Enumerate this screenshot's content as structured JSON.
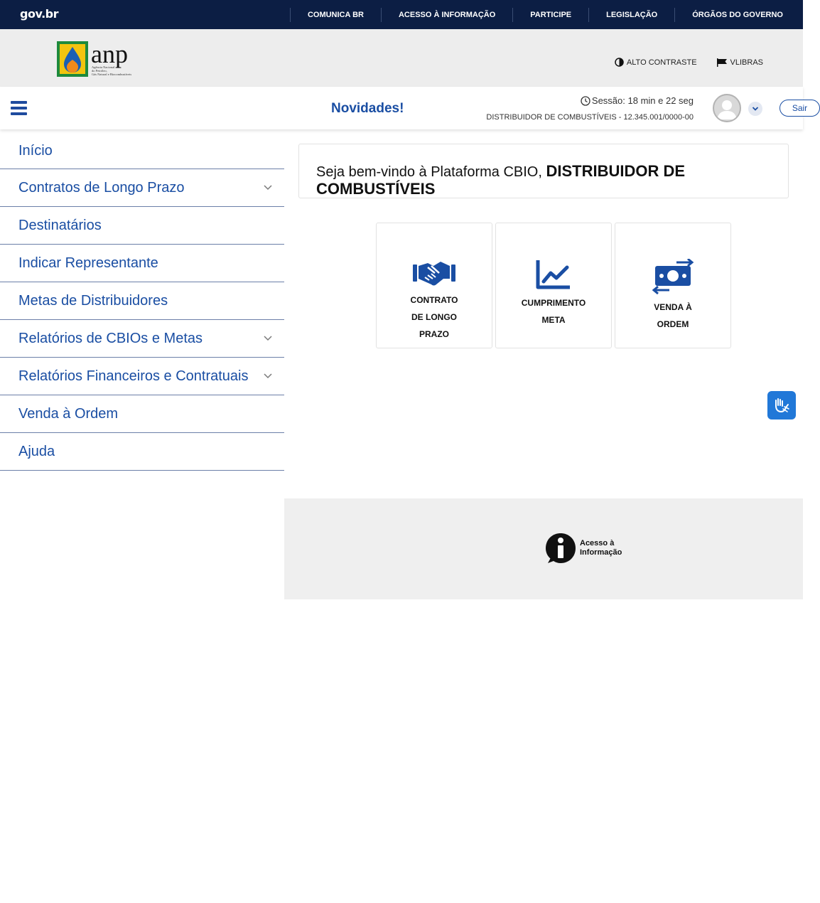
{
  "govbar": {
    "logo": "gov.br",
    "links": [
      "COMUNICA BR",
      "ACESSO À INFORMAÇÃO",
      "PARTICIPE",
      "LEGISLAÇÃO",
      "ÓRGÃOS DO GOVERNO"
    ]
  },
  "anp": {
    "logo_text": "anp",
    "logo_subtext": "Agência Nacional do Petróleo, Gás Natural e Biocombustíveis",
    "tools": {
      "contrast": "ALTO CONTRASTE",
      "vlibras": "VLIBRAS"
    }
  },
  "header": {
    "news": "Novidades!",
    "session": "Sessão: 18 min e 22 seg",
    "org": "DISTRIBUIDOR DE COMBUSTÍVEIS - 12.345.001/0000-00",
    "logout": "Sair"
  },
  "sidebar": {
    "items": [
      {
        "label": "Início",
        "has_children": false
      },
      {
        "label": "Contratos de Longo Prazo",
        "has_children": true
      },
      {
        "label": "Destinatários",
        "has_children": false
      },
      {
        "label": "Indicar Representante",
        "has_children": false
      },
      {
        "label": "Metas de Distribuidores",
        "has_children": false
      },
      {
        "label": "Relatórios de CBIOs e Metas",
        "has_children": true
      },
      {
        "label": "Relatórios Financeiros e Contratuais",
        "has_children": true
      },
      {
        "label": "Venda à Ordem",
        "has_children": false
      },
      {
        "label": "Ajuda",
        "has_children": false
      }
    ]
  },
  "welcome": {
    "prefix": "Seja bem-vindo à Plataforma CBIO,",
    "name": "DISTRIBUIDOR DE COMBUSTÍVEIS"
  },
  "cards": [
    {
      "label": "CONTRATO DE LONGO PRAZO",
      "icon": "handshake-icon"
    },
    {
      "label": "CUMPRIMENTO META",
      "icon": "chart-line-icon"
    },
    {
      "label": "VENDA À ORDEM",
      "icon": "money-exchange-icon"
    }
  ],
  "footer": {
    "access_info": "Acesso à Informação"
  },
  "colors": {
    "navy": "#0c1e44",
    "primary": "#1a4ea3",
    "libras": "#2178d8"
  }
}
